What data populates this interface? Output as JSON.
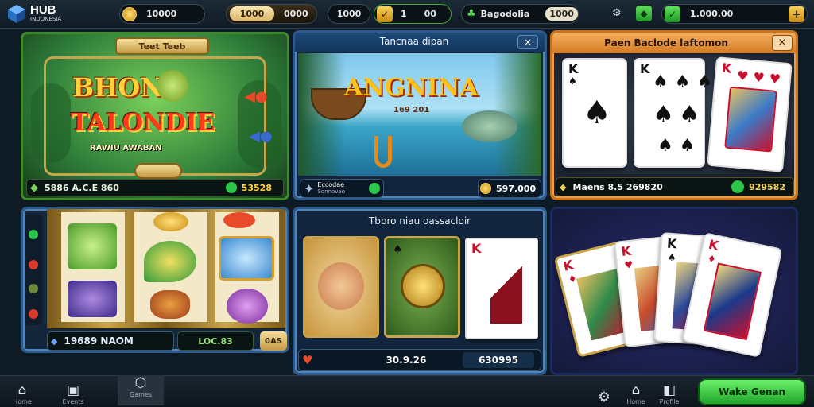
{
  "top_bar": {
    "logo_text": "HUB",
    "logo_sub": "INDONESIA",
    "coin_amount": "10000",
    "pill_two": "1000",
    "pill_two_right": "0000",
    "pill_three": "1000",
    "pill_four_left": "1",
    "pill_four_right": "00",
    "pill_five_label": "Bagodolia",
    "pill_five_right": "1000",
    "balance": "1.000.00",
    "add_label": "+"
  },
  "panels": {
    "fishing_game": {
      "banner": "Teet Teeb",
      "title_line1": "BHONU",
      "title_line2": "TALONDIE",
      "subtitle": "RAWIU AWABAN",
      "bar_text": "5886 A.C.E 860",
      "bar_value": "53528"
    },
    "angling": {
      "header": "Tancnaa dipan",
      "close": "×",
      "title": "ANGNINA",
      "caption": "169 201",
      "label_top": "Eccodae",
      "label_bottom": "Sonnovao",
      "value": "597.000"
    },
    "poker": {
      "header": "Paen Baclode laftomon",
      "close": "×",
      "cards": [
        {
          "rank": "K",
          "suit": "♠"
        },
        {
          "rank": "K",
          "suit": "♠"
        },
        {
          "rank": "K",
          "suit": "♥"
        }
      ],
      "bar_text": "Maens 8.5 269820",
      "bar_value": "929582"
    },
    "slots": {
      "bar_text": "19689 NAOM",
      "bar_value": "LOC.83",
      "button": "0AS"
    },
    "table_game": {
      "header": "Tbbro niau oassacloir",
      "card_rank": "K",
      "card_suit": "♠",
      "value_left": "30.9.26",
      "value_right": "630995"
    },
    "card_fan": {
      "cards": [
        {
          "rank": "K",
          "suit": "♦"
        },
        {
          "rank": "K",
          "suit": "♥"
        },
        {
          "rank": "K",
          "suit": "♠"
        },
        {
          "rank": "K",
          "suit": "♦"
        }
      ]
    }
  },
  "bottom_nav": {
    "items": [
      {
        "label": "Home",
        "icon": "home-icon"
      },
      {
        "label": "Events",
        "icon": "store-icon"
      },
      {
        "label": "Games",
        "icon": "games-icon"
      }
    ],
    "right_items": [
      {
        "label": "",
        "icon": "settings-icon"
      },
      {
        "label": "Home",
        "icon": "home-icon"
      },
      {
        "label": "Profile",
        "icon": "profile-icon"
      }
    ],
    "cta_label": "Wake Genan"
  },
  "colors": {
    "accent_green": "#2cc64a",
    "accent_orange": "#f0a040",
    "panel_blue": "#2d5a8a"
  }
}
